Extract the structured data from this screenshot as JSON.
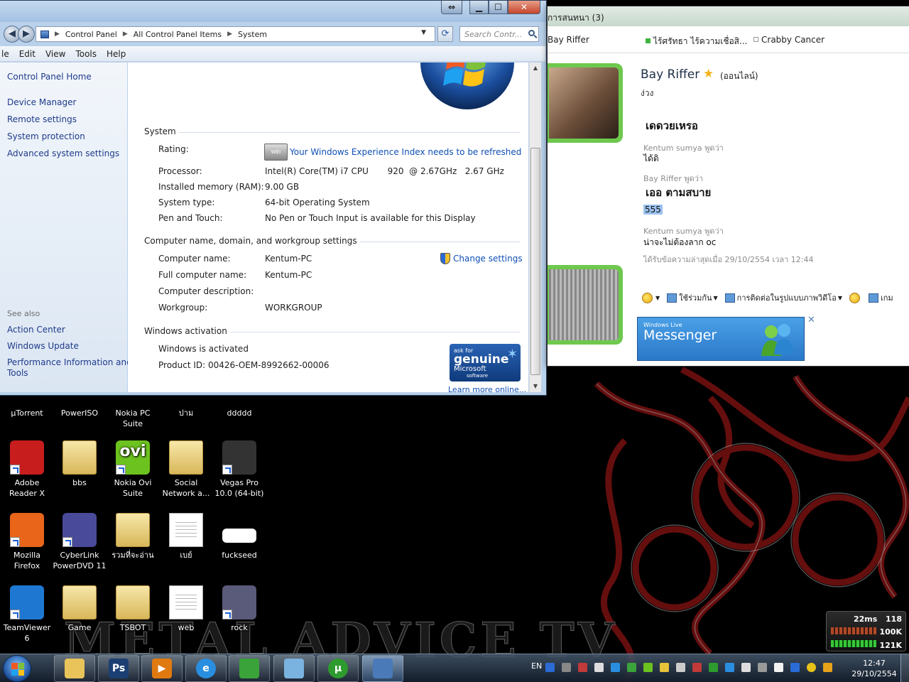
{
  "control_panel": {
    "breadcrumb": [
      "Control Panel",
      "All Control Panel Items",
      "System"
    ],
    "search_placeholder": "Search Contr...",
    "menu": [
      "le",
      "Edit",
      "View",
      "Tools",
      "Help"
    ],
    "sidebar": {
      "home": "Control Panel Home",
      "links": [
        "Device Manager",
        "Remote settings",
        "System protection",
        "Advanced system settings"
      ],
      "see_also_title": "See also",
      "see_also": [
        "Action Center",
        "Windows Update",
        "Performance Information and",
        "Tools"
      ]
    },
    "system": {
      "title": "System",
      "rating_label": "Rating:",
      "rating_link": "Your Windows Experience Index needs to be refreshed",
      "processor_label": "Processor:",
      "processor_value": "Intel(R) Core(TM) i7 CPU       920  @ 2.67GHz   2.67 GHz",
      "memory_label": "Installed memory (RAM):",
      "memory_value": "9.00 GB",
      "type_label": "System type:",
      "type_value": "64-bit Operating System",
      "pen_label": "Pen and Touch:",
      "pen_value": "No Pen or Touch Input is available for this Display"
    },
    "computer": {
      "title": "Computer name, domain, and workgroup settings",
      "change_settings": "Change settings",
      "name_label": "Computer name:",
      "name_value": "Kentum-PC",
      "full_label": "Full computer name:",
      "full_value": "Kentum-PC",
      "desc_label": "Computer description:",
      "workgroup_label": "Workgroup:",
      "workgroup_value": "WORKGROUP"
    },
    "activation": {
      "title": "Windows activation",
      "status": "Windows is activated",
      "product_id": "Product ID:  00426-OEM-8992662-00006",
      "learn_more": "Learn more online...",
      "badge_line1": "ask for",
      "badge_line2": "genuine",
      "badge_line3": "Microsoft",
      "badge_line4": "software"
    }
  },
  "messenger": {
    "title": "การสนทนา (3)",
    "tabs": [
      "Bay Riffer",
      "ไร้ศรัทธา ไร้ความเชื่อสิ...",
      "Crabby Cancer"
    ],
    "contact_name": "Bay Riffer",
    "contact_status": "(ออนไลน์)",
    "mood": "ง่วง",
    "conversation": [
      {
        "kind": "big",
        "text": "เดดวยเหรอ"
      },
      {
        "kind": "said",
        "text": "Kentum sumya พูดว่า"
      },
      {
        "kind": "msg",
        "text": "ได้ดิ"
      },
      {
        "kind": "said",
        "text": "Bay Riffer พูดว่า"
      },
      {
        "kind": "big",
        "text": "เออ ตามสบาย"
      },
      {
        "kind": "hl",
        "text": "555"
      },
      {
        "kind": "said",
        "text": "Kentum sumya พูดว่า"
      },
      {
        "kind": "msg",
        "text": "น่าจะไม่ต้องลาก oc"
      },
      {
        "kind": "said",
        "text": "ได้รับข้อความล่าสุดเมื่อ 29/10/2554 เวลา 12:44"
      }
    ],
    "toolbar": [
      "ใช้ร่วมกัน",
      "การติดต่อในรูปแบบภาพวิดีโอ",
      "เกม"
    ],
    "banner_line1": "Windows Live",
    "banner_line2": "Messenger",
    "close_glyph": "✕"
  },
  "desktop_icons": [
    {
      "label": "µTorrent",
      "col": 0,
      "row": 0,
      "color": "#2e7d32"
    },
    {
      "label": "PowerISO",
      "col": 1,
      "row": 0,
      "color": "#555"
    },
    {
      "label": "Nokia PC Suite",
      "col": 2,
      "row": 0,
      "color": "#1a4fa0"
    },
    {
      "label": "ปาม",
      "col": 3,
      "row": 0,
      "color": "#c9a24a"
    },
    {
      "label": "ddddd",
      "col": 4,
      "row": 0,
      "color": "#c9a24a"
    },
    {
      "label": "Adobe Reader X",
      "col": 0,
      "row": 1,
      "color": "#c81d1d"
    },
    {
      "label": "bbs",
      "col": 1,
      "row": 1,
      "color": "folder"
    },
    {
      "label": "Nokia Ovi Suite",
      "col": 2,
      "row": 1,
      "color": "#6cc21f"
    },
    {
      "label": "Social Network a...",
      "col": 3,
      "row": 1,
      "color": "folder"
    },
    {
      "label": "Vegas Pro 10.0 (64-bit)",
      "col": 4,
      "row": 1,
      "color": "#333"
    },
    {
      "label": "Mozilla Firefox",
      "col": 0,
      "row": 2,
      "color": "#e8651a"
    },
    {
      "label": "CyberLink PowerDVD 11",
      "col": 1,
      "row": 2,
      "color": "#4a4a9a"
    },
    {
      "label": "รวมที่จะอ่าน",
      "col": 2,
      "row": 2,
      "color": "folder"
    },
    {
      "label": "เบย์",
      "col": 3,
      "row": 2,
      "color": "doc"
    },
    {
      "label": "fuckseed",
      "col": 4,
      "row": 2,
      "color": "#ffffff"
    },
    {
      "label": "TeamViewer 6",
      "col": 0,
      "row": 3,
      "color": "#1e78d2"
    },
    {
      "label": "Game",
      "col": 1,
      "row": 3,
      "color": "folder"
    },
    {
      "label": "TSBOT",
      "col": 2,
      "row": 3,
      "color": "folder"
    },
    {
      "label": "web",
      "col": 3,
      "row": 3,
      "color": "doc"
    },
    {
      "label": "rock",
      "col": 4,
      "row": 3,
      "color": "#5a5a7a"
    }
  ],
  "ovi_text": "ovi",
  "wallpaper_text": "METAL ADVICE TV",
  "taskbar": {
    "buttons": [
      {
        "name": "explorer",
        "glyph": "",
        "color": "#e8c45a"
      },
      {
        "name": "photoshop",
        "glyph": "Ps",
        "color": "#1c3f73"
      },
      {
        "name": "media-player",
        "glyph": "▶",
        "color": "#e07a10"
      },
      {
        "name": "internet-explorer",
        "glyph": "e",
        "color": "#2a8ee0"
      },
      {
        "name": "messenger",
        "glyph": "",
        "color": "#3aa33a"
      },
      {
        "name": "notepad",
        "glyph": "",
        "color": "#7ab2e0"
      },
      {
        "name": "utorrent",
        "glyph": "µ",
        "color": "#2e9b2e"
      },
      {
        "name": "control-panel",
        "glyph": "",
        "color": "#4a7ab8"
      }
    ],
    "language": "EN",
    "time": "12:47",
    "date": "29/10/2554"
  },
  "net_meter": {
    "ping": "22ms",
    "v1": "118",
    "v2": "100K",
    "v3": "121K"
  }
}
